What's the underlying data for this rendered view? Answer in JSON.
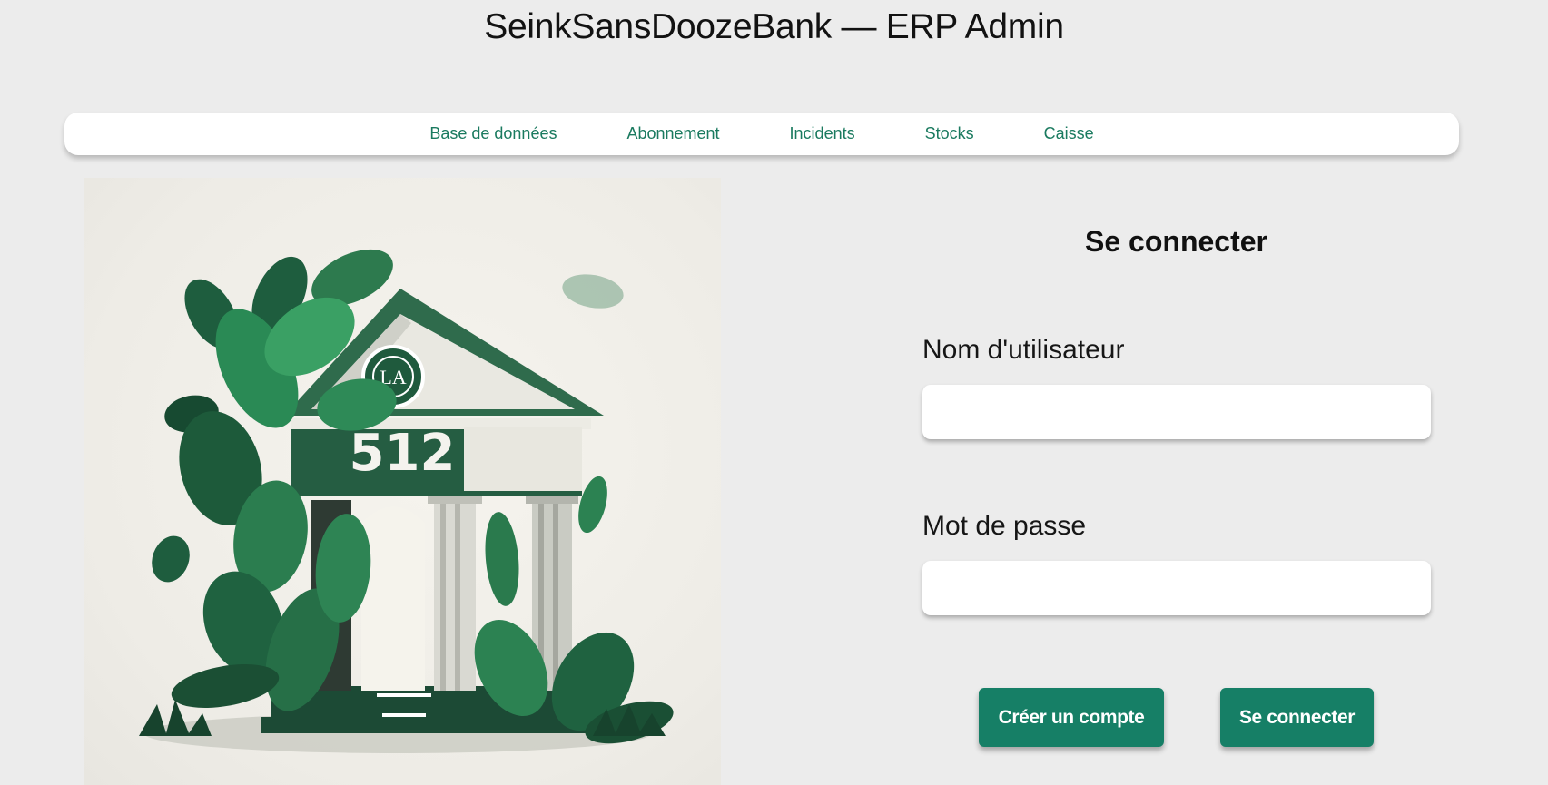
{
  "header": {
    "title": "SeinkSansDoozeBank — ERP Admin"
  },
  "nav": {
    "items": [
      {
        "label": "Base de données"
      },
      {
        "label": "Abonnement"
      },
      {
        "label": "Incidents"
      },
      {
        "label": "Stocks"
      },
      {
        "label": "Caisse"
      }
    ]
  },
  "hero": {
    "image": "bank-building-with-leaves-illustration",
    "building_number": "512",
    "emblem_text": "LA"
  },
  "login": {
    "title": "Se connecter",
    "username_label": "Nom d'utilisateur",
    "username_value": "",
    "password_label": "Mot de passe",
    "password_value": "",
    "create_account_label": "Créer un compte",
    "submit_label": "Se connecter"
  },
  "colors": {
    "background": "#ececec",
    "accent": "#167f66",
    "nav_link": "#1a7a5f",
    "foliage_dark": "#1f5a3c",
    "foliage_light": "#3a9a62"
  }
}
